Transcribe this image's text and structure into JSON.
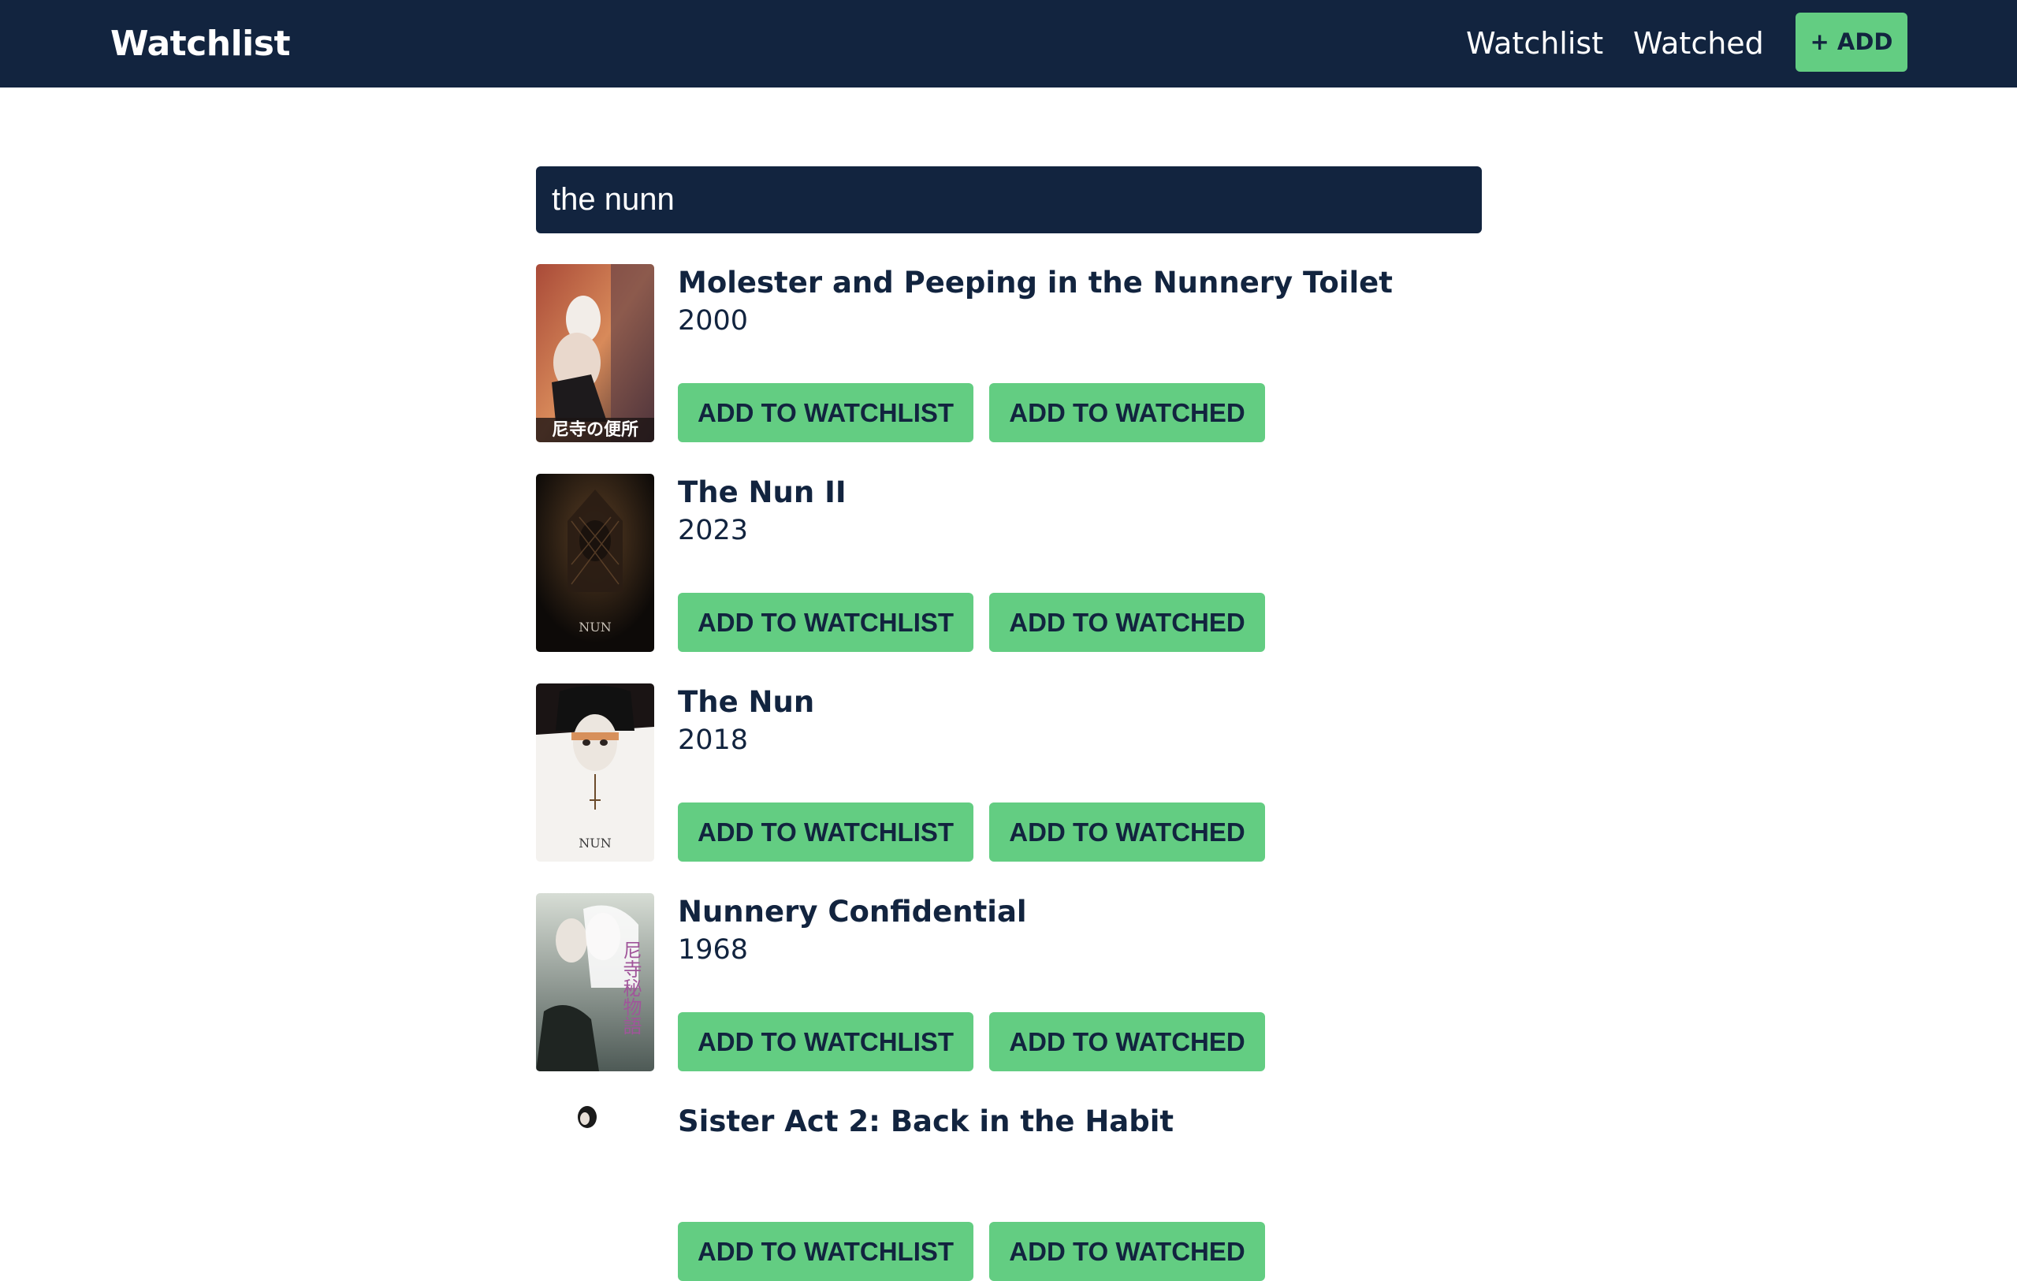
{
  "header": {
    "brand": "Watchlist",
    "nav": {
      "watchlist": "Watchlist",
      "watched": "Watched"
    },
    "add_label": "+ ADD"
  },
  "search": {
    "value": "the nunn"
  },
  "results": [
    {
      "title": "Molester and Peeping in the Nunnery Toilet",
      "year": "2000",
      "poster_text": "尼寺の便所",
      "watchlist_label": "ADD TO WATCHLIST",
      "watched_label": "ADD TO WATCHED"
    },
    {
      "title": "The Nun II",
      "year": "2023",
      "poster_text": "NUN",
      "watchlist_label": "ADD TO WATCHLIST",
      "watched_label": "ADD TO WATCHED"
    },
    {
      "title": "The Nun",
      "year": "2018",
      "poster_text": "NUN",
      "watchlist_label": "ADD TO WATCHLIST",
      "watched_label": "ADD TO WATCHED"
    },
    {
      "title": "Nunnery Confidential",
      "year": "1968",
      "poster_text": "尼寺秘物語",
      "watchlist_label": "ADD TO WATCHLIST",
      "watched_label": "ADD TO WATCHED"
    },
    {
      "title": "Sister Act 2: Back in the Habit",
      "year": "",
      "poster_text": "",
      "watchlist_label": "ADD TO WATCHLIST",
      "watched_label": "ADD TO WATCHED"
    }
  ],
  "colors": {
    "navy": "#12243f",
    "accent_green": "#63cd82",
    "background": "#ffffff"
  }
}
